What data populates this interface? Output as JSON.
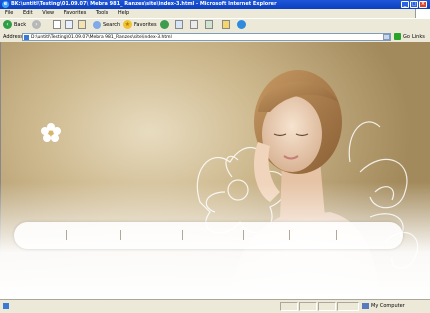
{
  "window": {
    "title": "BK:\\untitl\\Testing\\01.09.07\\ Mebra 981_ Ranzes\\site\\index-3.html - Microsoft Internet Explorer",
    "minimize": "_",
    "maximize": "□",
    "close": "×"
  },
  "menu": {
    "items": [
      "File",
      "Edit",
      "View",
      "Favorites",
      "Tools",
      "Help"
    ]
  },
  "toolbar": {
    "back_label": "Back",
    "search_label": "Search",
    "favorites_label": "Favorites"
  },
  "address": {
    "label": "Address",
    "value": "D:\\untitl\\Testing\\01.09.07\\Mebra 981_Ranzes\\site\\index-3.html",
    "go_label": "Go",
    "links_label": "Links"
  },
  "status": {
    "zone_label": "My Computer"
  },
  "colors": {
    "title_bar": "#0a3fbf",
    "chrome": "#ece9d8",
    "page_bg": "#cdb88d"
  }
}
